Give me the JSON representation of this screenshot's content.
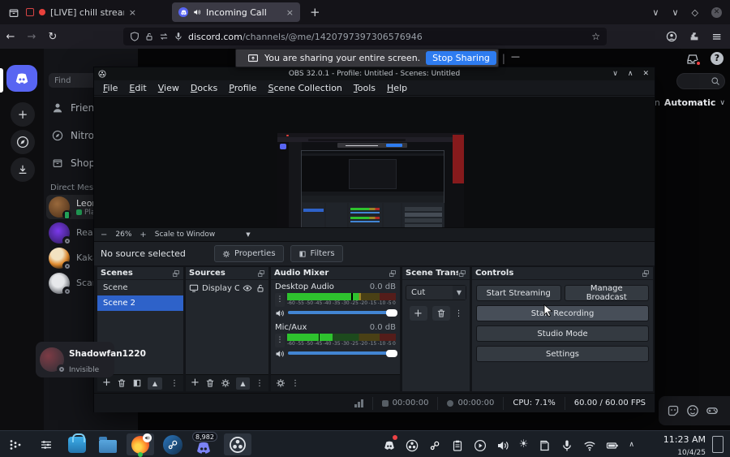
{
  "colors": {
    "discord-brand": "#5865f2",
    "accent-blue": "#2e7cf0",
    "selection-blue": "#2e62c9",
    "slider-blue": "#4285d3",
    "live-red": "#e8413c",
    "meter-green": "#2ec22e",
    "meter-yellow": "#9b8426",
    "meter-red": "#b02a26"
  },
  "browser": {
    "tab1": "[LIVE] chill stream",
    "tab2": "Incoming Call",
    "new_tab": "+",
    "url_domain": "discord.com",
    "url_path": "/channels/@me/1420797397306576946"
  },
  "banner": {
    "message": "You are sharing your entire screen.",
    "stop": "Stop Sharing"
  },
  "discord": {
    "find": "Find",
    "nav": [
      "Friends",
      "Nitro",
      "Shop"
    ],
    "dm_header": "Direct Messa",
    "dms": [
      {
        "name": "Leon",
        "sub": "Pla"
      },
      {
        "name": "Reap",
        "sub": ""
      },
      {
        "name": "Kaka",
        "sub": ""
      },
      {
        "name": "Scar",
        "sub": ""
      }
    ],
    "region_partial": "egion",
    "region_value": "Automatic",
    "user": {
      "name": "Shadowfan1220",
      "status": "Invisible"
    }
  },
  "obs": {
    "title": "OBS 32.0.1 - Profile: Untitled - Scenes: Untitled",
    "menu": [
      "File",
      "Edit",
      "View",
      "Docks",
      "Profile",
      "Scene Collection",
      "Tools",
      "Help"
    ],
    "zoom_out": "−",
    "zoom_value": "26%",
    "zoom_in": "+",
    "scale_mode": "Scale to Window",
    "no_source": "No source selected",
    "properties": "Properties",
    "filters": "Filters",
    "scenes": {
      "title": "Scenes",
      "items": [
        "Scene",
        "Scene 2"
      ],
      "selected_index": 1
    },
    "sources": {
      "title": "Sources",
      "item": "Display Ca"
    },
    "mixer": {
      "title": "Audio Mixer",
      "channels": [
        {
          "name": "Desktop Audio",
          "db": "0.0 dB",
          "level": 68,
          "mark": 59,
          "slider": 96
        },
        {
          "name": "Mic/Aux",
          "db": "0.0 dB",
          "level": 42,
          "mark": 29,
          "slider": 96
        }
      ],
      "scale": [
        "-60",
        "-55",
        "-50",
        "-45",
        "-40",
        "-35",
        "-30",
        "-25",
        "-20",
        "-15",
        "-10",
        "-5",
        "0"
      ]
    },
    "transitions": {
      "title": "Scene Transit...",
      "value": "Cut"
    },
    "controls": {
      "title": "Controls",
      "start_streaming": "Start Streaming",
      "manage_broadcast": "Manage Broadcast",
      "start_recording": "Start Recording",
      "studio_mode": "Studio Mode",
      "settings": "Settings"
    },
    "status": {
      "stream_time": "00:00:00",
      "rec_time": "00:00:00",
      "cpu": "CPU: 7.1%",
      "fps": "60.00 / 60.00 FPS"
    }
  },
  "taskbar": {
    "discord_badge": "8,982",
    "time": "11:23 AM",
    "date": "10/4/25"
  }
}
